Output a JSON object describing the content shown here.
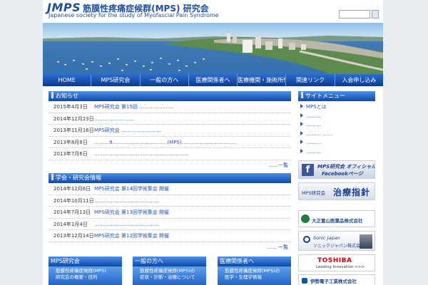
{
  "header": {
    "logo_mark": "JMPS",
    "logo_title": "筋膜性疼痛症候群(MPS) 研究会",
    "logo_subtitle": "Japanese society for the study of Myofascial Pain Syndrome",
    "search_placeholder": ""
  },
  "nav": {
    "items": [
      {
        "label": "HOME"
      },
      {
        "label": "MPS研究会"
      },
      {
        "label": "一般の方へ"
      },
      {
        "label": "医療関係者へ"
      },
      {
        "label": "医療機関・施術所情報"
      },
      {
        "label": "関連リンク"
      },
      {
        "label": "入会申し込み"
      }
    ]
  },
  "news": {
    "title": "お知らせ",
    "items": [
      {
        "date": "2015年4月3日",
        "text": "MPS研究会 第15回 …………………"
      },
      {
        "date": "2014年12月23日",
        "text": "……………………"
      },
      {
        "date": "2013年11月16日",
        "text": "MPS研究会 ……………………"
      },
      {
        "date": "2013年8月8日",
        "text": "………9……………………………(MPS)……………………………"
      },
      {
        "date": "2013年7月6日",
        "text": "…………………………………………………"
      }
    ],
    "more": "……一覧"
  },
  "events": {
    "title": "学会・研究会情報",
    "items": [
      {
        "date": "2014年12月6日",
        "text": "MPS研究会 第14回学術集会 開催"
      },
      {
        "date": "2014年10月11日",
        "text": "…………………………………"
      },
      {
        "date": "2014年7月13日",
        "text": "MPS研究会 第13回学術集会 開催"
      },
      {
        "date": "2014年1月4日",
        "text": "…………………………………"
      },
      {
        "date": "2013年12月14日",
        "text": "MPS研究会 第12回学術集会 開催"
      }
    ],
    "more": "…… 一覧"
  },
  "sidebar": {
    "title": "サイトメニュー",
    "items": [
      {
        "label": "MPSとは"
      },
      {
        "label": "………"
      },
      {
        "label": "………"
      },
      {
        "label": "……… ……"
      },
      {
        "label": "………"
      },
      {
        "label": "………"
      }
    ],
    "facebook": {
      "title": "MPS研究会 オフィシャル",
      "subtitle": "Facebookページ"
    },
    "guidelines": {
      "org": "MPS研究会",
      "title": "治療指針"
    },
    "sponsors": [
      {
        "name": "大正富山医薬品株式会社"
      },
      {
        "name": "Sonic Japan",
        "name_jp": "ソニックジャパン株式会社"
      },
      {
        "name": "TOSHIBA",
        "tagline": "Leading Innovation >>>"
      },
      {
        "name": "伊勢電子工業株式会社"
      }
    ]
  },
  "cards": [
    {
      "title": "MPS研究会",
      "line1": "筋膜性疼痛症候群(MPS)",
      "line2": "研究会の概要・目的"
    },
    {
      "title": "一般の方へ",
      "line1": "筋膜性疼痛症候群(MPS)の",
      "line2": "症状・診断・治療について"
    },
    {
      "title": "医療関係者へ",
      "line1": "筋膜性疼痛症候群(MPS)の",
      "line2": "医学・生理学情報"
    }
  ],
  "colors": {
    "nav": "#0c3a91",
    "heading": "#0f4aa8",
    "link": "#2553b8",
    "logo": "#1d4f9e",
    "page_bg": "#e9ecf1"
  }
}
